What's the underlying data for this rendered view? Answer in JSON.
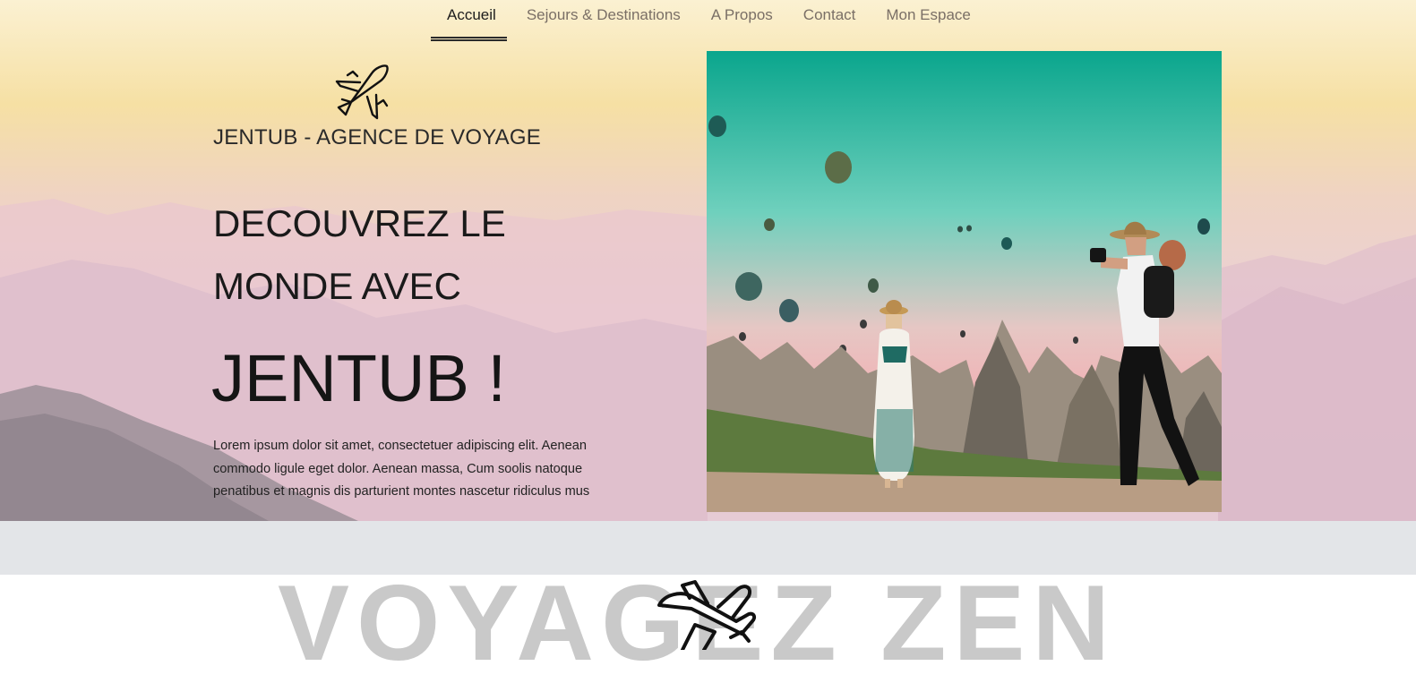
{
  "nav": {
    "items": [
      {
        "label": "Accueil",
        "active": true
      },
      {
        "label": "Sejours & Destinations",
        "active": false
      },
      {
        "label": "A Propos",
        "active": false
      },
      {
        "label": "Contact",
        "active": false
      },
      {
        "label": "Mon Espace",
        "active": false
      }
    ]
  },
  "hero": {
    "brand": "JENTUB - AGENCE DE VOYAGE",
    "headline_line1": "DECOUVREZ LE",
    "headline_line2": "MONDE AVEC",
    "headline_line3": "JENTUB !",
    "body": "Lorem ipsum dolor sit amet, consectetuer adipiscing elit. Aenean commodo ligule eget dolor. Aenean massa, Cum soolis natoque penatibus et magnis dis parturient montes nascetur ridiculus mus",
    "logo_icon": "airplane-icon"
  },
  "section": {
    "heading": "VOYAGEZ ZEN",
    "icon": "airplane-icon"
  },
  "colors": {
    "band": "#e3e5e8",
    "headline": "#1a1a1a",
    "nav_active": "#1d1d1d",
    "nav_inactive": "#7a6f66",
    "zen_text": "#c9c9c9"
  }
}
